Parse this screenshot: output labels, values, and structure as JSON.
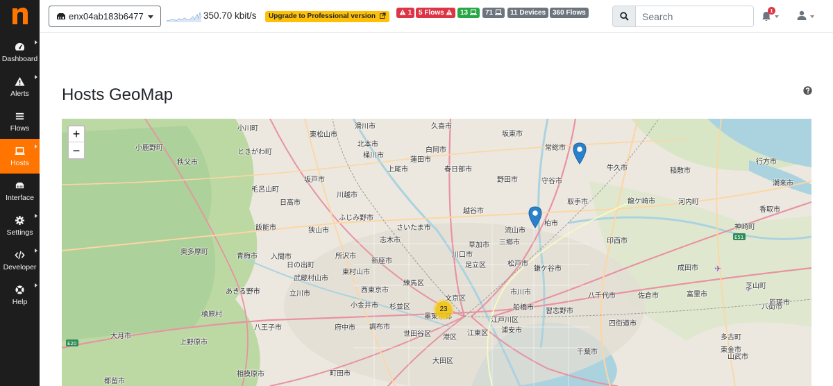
{
  "sidebar": {
    "items": [
      {
        "label": "Dashboard",
        "icon": "dashboard-icon"
      },
      {
        "label": "Alerts",
        "icon": "alert-icon"
      },
      {
        "label": "Flows",
        "icon": "flows-icon"
      },
      {
        "label": "Hosts",
        "icon": "laptop-icon",
        "active": true
      },
      {
        "label": "Interface",
        "icon": "ethernet-icon"
      },
      {
        "label": "Settings",
        "icon": "gear-icon"
      },
      {
        "label": "Developer",
        "icon": "code-icon"
      },
      {
        "label": "Help",
        "icon": "life-ring-icon"
      }
    ]
  },
  "topbar": {
    "interface": "enx04ab183b6477",
    "throughput": "350.70 kbit/s",
    "upgrade_label": "Upgrade to Professional version",
    "badges": {
      "alerts": "1",
      "flow_alerts": "5 Flows",
      "local_hosts": "13",
      "remote_hosts": "71",
      "devices": "11 Devices",
      "flows": "360 Flows"
    },
    "search_placeholder": "Search",
    "notification_count": "1"
  },
  "page": {
    "title": "Hosts GeoMap"
  },
  "map": {
    "cluster_count": "23",
    "labels": [
      "滑川市",
      "久喜市",
      "坂東市",
      "東松山市",
      "北本市",
      "白岡市",
      "常総市",
      "小川町",
      "桶川市",
      "蓮田市",
      "小鹿野町",
      "ときがわ町",
      "上尾市",
      "春日部市",
      "牛久市",
      "稲敷市",
      "行方市",
      "秩父市",
      "坂戸市",
      "野田市",
      "守谷市",
      "潮来市",
      "毛呂山町",
      "川越市",
      "日高市",
      "ふじみ野市",
      "越谷市",
      "取手市",
      "龍ケ崎市",
      "河内町",
      "香取市",
      "飯能市",
      "狭山市",
      "さいたま市",
      "流山市",
      "柏市",
      "神崎町",
      "志木市",
      "草加市",
      "三郷市",
      "印西市",
      "所沢市",
      "川口市",
      "入間市",
      "青梅市",
      "新座市",
      "足立区",
      "松戸市",
      "鎌ケ谷市",
      "成田市",
      "奥多摩町",
      "東村山市",
      "日の出町",
      "武蔵村山市",
      "練馬区",
      "文京区",
      "市川市",
      "八千代市",
      "佐倉市",
      "富里市",
      "あきる野市",
      "立川市",
      "西東京市",
      "小金井市",
      "杉並区",
      "墨東京都",
      "船橋市",
      "芝山町",
      "八街市",
      "匝瑳市",
      "檜原村",
      "八王子市",
      "府中市",
      "調布市",
      "世田谷区",
      "江戸川区",
      "習志野市",
      "四街道市",
      "多古町",
      "東金市",
      "大月市",
      "上野原市",
      "港区",
      "江東区",
      "浦安市",
      "千葉市",
      "山武市",
      "町田市",
      "大田区",
      "相模原市",
      "都留市"
    ]
  },
  "colors": {
    "sidebar_bg": "#1d1d1d",
    "accent": "#ff7500",
    "badge_red": "#dc3545",
    "badge_green": "#28a745",
    "badge_gray": "#6c757d",
    "upgrade_bg": "#ffc107",
    "marker_blue": "#2a81cb",
    "cluster_yellow": "#f0c20c"
  }
}
